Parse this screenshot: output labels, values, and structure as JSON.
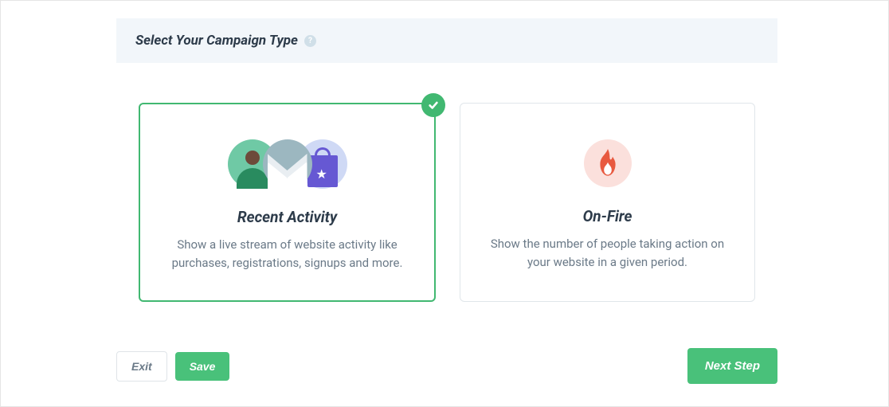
{
  "header": {
    "title": "Select Your Campaign Type"
  },
  "cards": {
    "recent": {
      "title": "Recent Activity",
      "desc": "Show a live stream of website activity like purchases, registrations, signups and more.",
      "selected": true
    },
    "onfire": {
      "title": "On-Fire",
      "desc": "Show the number of people taking action on your website in a given period.",
      "selected": false
    }
  },
  "footer": {
    "exit": "Exit",
    "save": "Save",
    "next": "Next Step"
  }
}
